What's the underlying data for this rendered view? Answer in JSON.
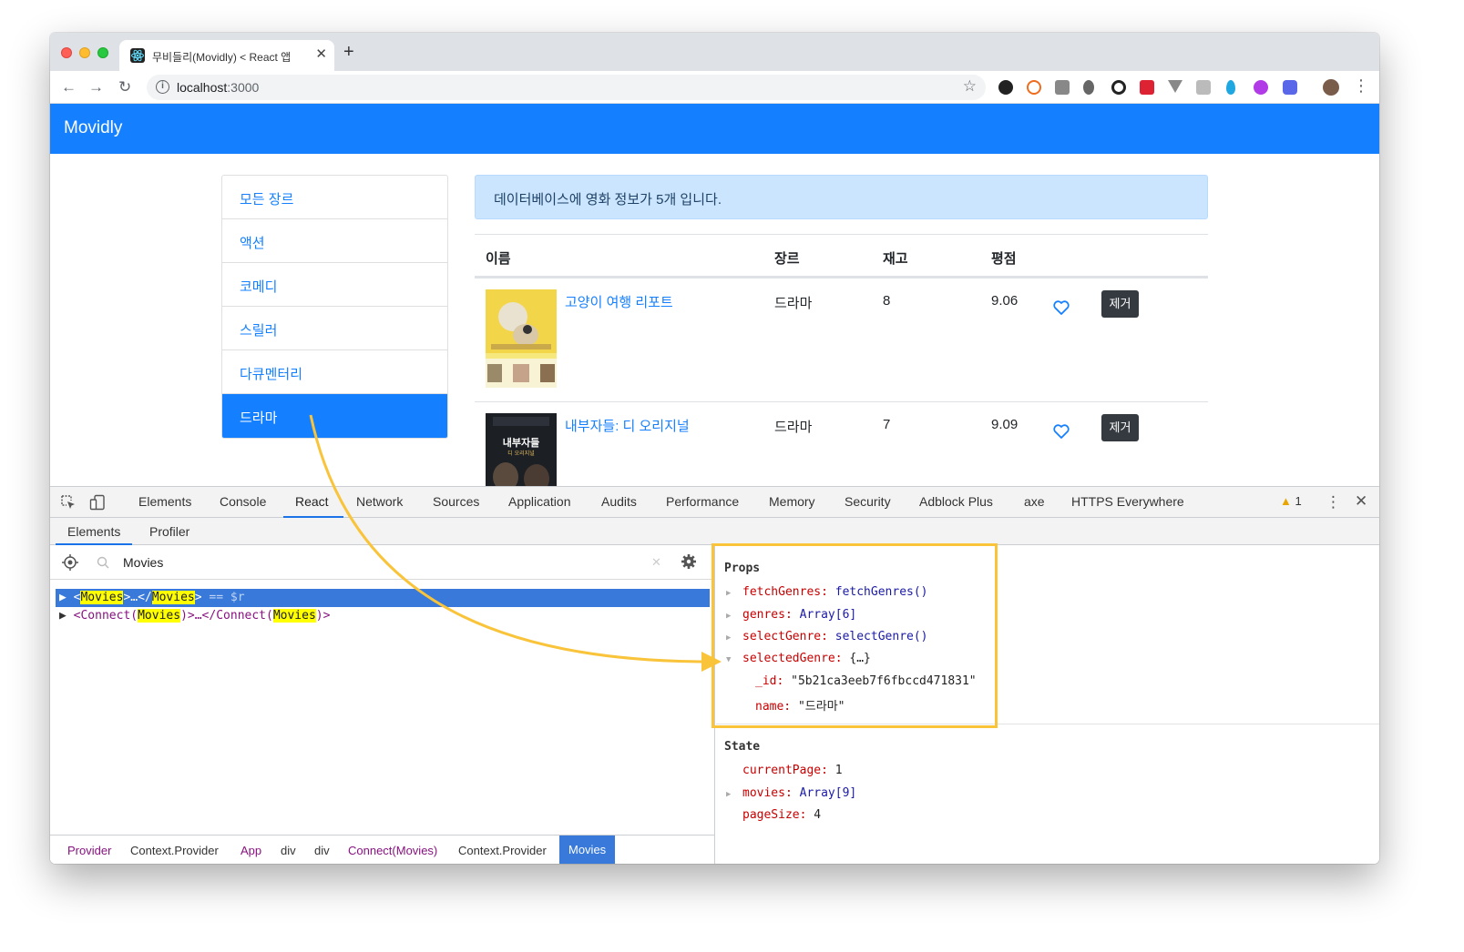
{
  "browser": {
    "tab_title": "무비들리(Movidly) < React 앱",
    "url_host": "localhost",
    "url_port": ":3000"
  },
  "app": {
    "brand": "Movidly",
    "genres": [
      "모든 장르",
      "액션",
      "코메디",
      "스릴러",
      "다큐멘터리",
      "드라마"
    ],
    "active_genre_index": 5,
    "count_message": "데이터베이스에 영화 정보가 5개 입니다.",
    "table_headers": [
      "이름",
      "장르",
      "재고",
      "평점"
    ],
    "movies": [
      {
        "title": "고양이 여행 리포트",
        "genre": "드라마",
        "stock": "8",
        "rating": "9.06",
        "delete_label": "제거"
      },
      {
        "title": "내부자들: 디 오리지널",
        "genre": "드라마",
        "stock": "7",
        "rating": "9.09",
        "delete_label": "제거"
      }
    ]
  },
  "devtools": {
    "tabs": [
      "Elements",
      "Console",
      "React",
      "Network",
      "Sources",
      "Application",
      "Audits",
      "Performance",
      "Memory",
      "Security",
      "Adblock Plus",
      "axe",
      "HTTPS Everywhere"
    ],
    "active_tab": "React",
    "warning_count": "1",
    "subtabs": [
      "Elements",
      "Profiler"
    ],
    "search_value": "Movies",
    "tree": {
      "row1": {
        "open": "<",
        "name": "Movies",
        "mid": ">…</",
        "name2": "Movies",
        "close": ">",
        "suffix": " == $r"
      },
      "row2": {
        "open": "<Connect(",
        "name": "Movies",
        "mid": ")>…</Connect(",
        "name2": "Movies",
        "close": ")>"
      }
    },
    "breadcrumbs": [
      "Provider",
      "Context.Provider",
      "App",
      "div",
      "div",
      "Connect(Movies)",
      "Context.Provider",
      "Movies"
    ],
    "props_heading": "Props",
    "props": [
      {
        "key": "fetchGenres:",
        "value": "fetchGenres()"
      },
      {
        "key": "genres:",
        "value": "Array[6]"
      },
      {
        "key": "selectGenre:",
        "value": "selectGenre()"
      },
      {
        "key": "selectedGenre:",
        "value": "{…}"
      }
    ],
    "selected_genre_fields": [
      {
        "key": "_id:",
        "value": "\"5b21ca3eeb7f6fbccd471831\""
      },
      {
        "key": "name:",
        "value": "\"드라마\""
      }
    ],
    "state_heading": "State",
    "state": [
      {
        "key": "currentPage:",
        "value": "1"
      },
      {
        "key": "movies:",
        "value": "Array[9]"
      },
      {
        "key": "pageSize:",
        "value": "4"
      }
    ]
  },
  "colors": {
    "primary": "#1580ff",
    "annotation": "#f9c33a",
    "devtools_selection": "#3879d9"
  }
}
